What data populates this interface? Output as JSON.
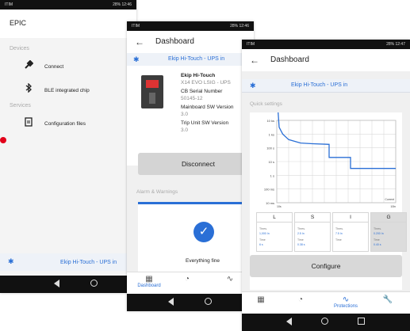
{
  "phone1": {
    "status": {
      "left": "ITIM",
      "right": "28% 12:46"
    },
    "app_title": "EPIC",
    "devices_header": "Devices",
    "services_header": "Services",
    "items": [
      {
        "icon": "plug-icon",
        "label": "Connect"
      },
      {
        "icon": "bluetooth-icon",
        "label": "BLE integrated chip"
      },
      {
        "icon": "document-icon",
        "label": "Configuration files"
      }
    ],
    "bottom_device": "Ekip Hi-Touch - UPS in"
  },
  "phone2": {
    "status": {
      "left": "ITIM",
      "right": "28% 12:46"
    },
    "title": "Dashboard",
    "device_name_bar": "Ekip Hi-Touch - UPS in",
    "device": {
      "name": "Ekip Hi-Touch",
      "model": "X14 EVO LSIG - UPS",
      "serial_label": "CB Serial Number",
      "serial_value": "50145-12",
      "mainboard_label": "Mainboard SW Version",
      "mainboard_value": "3.0",
      "trip_label": "Trip Unit SW Version",
      "trip_value": "3.0"
    },
    "disconnect_label": "Disconnect",
    "alarm_title": "Alarm & Warnings",
    "everything_fine": "Everything fine",
    "tabs": [
      {
        "icon": "dashboard-icon",
        "label": "Dashboard"
      },
      {
        "icon": "gauge-icon",
        "label": ""
      },
      {
        "icon": "waveform-icon",
        "label": ""
      }
    ]
  },
  "phone3": {
    "status": {
      "left": "ITIM",
      "right": "28% 12:47"
    },
    "title": "Dashboard",
    "device_name_bar": "Ekip Hi-Touch - UPS in",
    "quick_settings": "Quick settings",
    "chart_data": {
      "type": "line",
      "title": "",
      "ylabel": "",
      "xlabel": "Current",
      "x_ticks": [
        "10s",
        "10ln"
      ],
      "y_ticks": [
        "10 ks",
        "1 ks",
        "100 s",
        "10 s",
        "1 s",
        "100 ms",
        "10 ms"
      ],
      "series": [
        {
          "x": [
            0,
            0.02,
            0.05,
            0.1,
            0.2,
            0.3,
            0.44,
            0.44,
            0.62,
            0.62,
            1.0
          ],
          "y": [
            6,
            3.5,
            3.0,
            2.6,
            2.35,
            2.3,
            2.25,
            1.3,
            1.3,
            0.5,
            0.5
          ]
        }
      ]
    },
    "params": [
      {
        "label": "L",
        "thres_label": "Thres.",
        "thres_value": "1,000 In",
        "time_label": "Time",
        "time_value": "6 s"
      },
      {
        "label": "S",
        "thres_label": "Thres.",
        "thres_value": "2.5 In",
        "time_label": "Time",
        "time_value": "0.38 s"
      },
      {
        "label": "I",
        "thres_label": "Thres.",
        "thres_value": "7.5 In",
        "time_label": "Time",
        "time_value": ""
      },
      {
        "label": "G",
        "thres_label": "Thres.",
        "thres_value": "0.200 In",
        "time_label": "Time",
        "time_value": "0.40 s"
      }
    ],
    "configure_label": "Configure",
    "tabs": [
      {
        "icon": "dashboard-icon",
        "label": ""
      },
      {
        "icon": "gauge-icon",
        "label": ""
      },
      {
        "icon": "waveform-icon",
        "label": "Protections"
      },
      {
        "icon": "wrench-icon",
        "label": ""
      }
    ]
  }
}
